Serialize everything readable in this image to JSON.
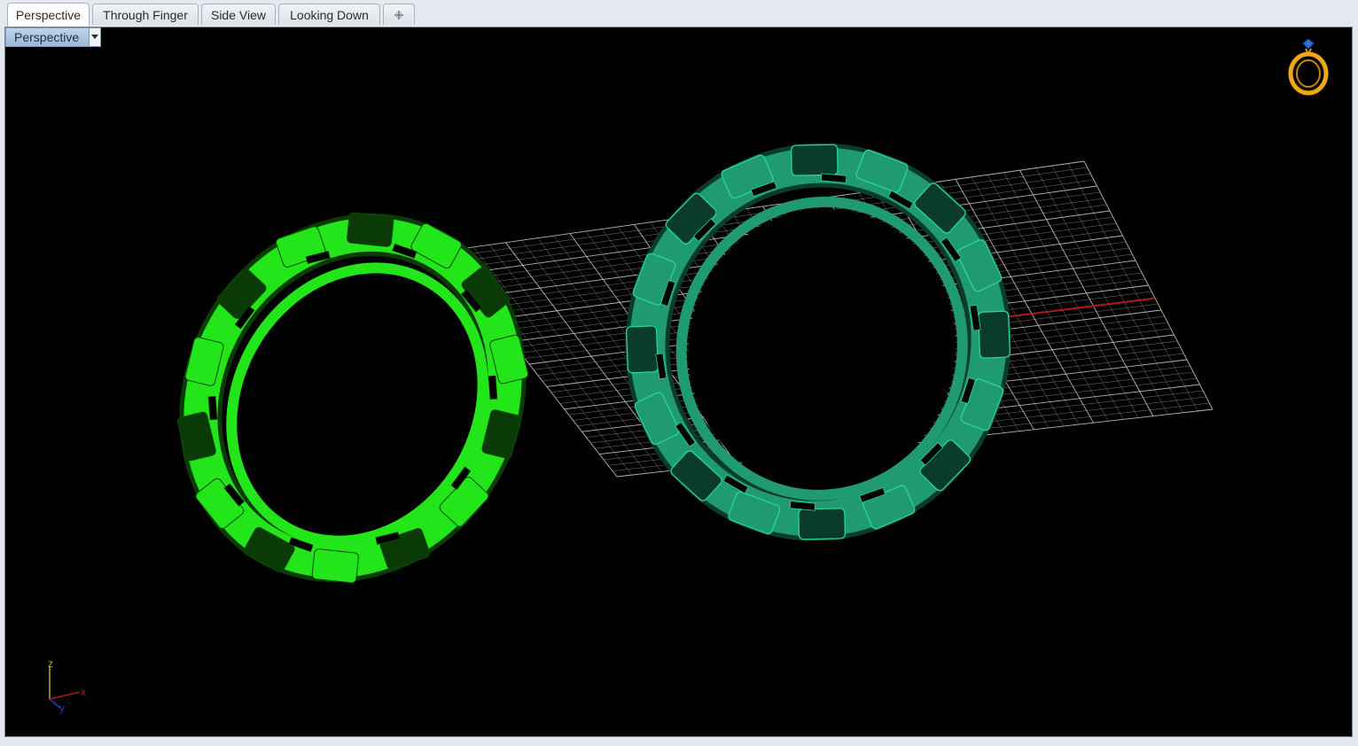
{
  "tabs": [
    {
      "label": "Perspective",
      "active": true
    },
    {
      "label": "Through Finger",
      "active": false
    },
    {
      "label": "Side View",
      "active": false
    },
    {
      "label": "Looking Down",
      "active": false
    }
  ],
  "add_tab_icon": "plus-icon",
  "viewport": {
    "label": "Perspective",
    "menu_icon": "chevron-down-icon",
    "background": "#000000",
    "logo_icon": "ring-icon",
    "axis_labels": {
      "z": "z",
      "x": "x",
      "y": "y"
    }
  },
  "scene": {
    "grid_color": "#c8c8c8",
    "x_axis_color": "#b01818",
    "y_axis_color": "#1a3fb5",
    "ring_left_color": "#22e619",
    "ring_right_color": "#1f9a72",
    "ring_right_edge_color": "#27d5a0"
  }
}
